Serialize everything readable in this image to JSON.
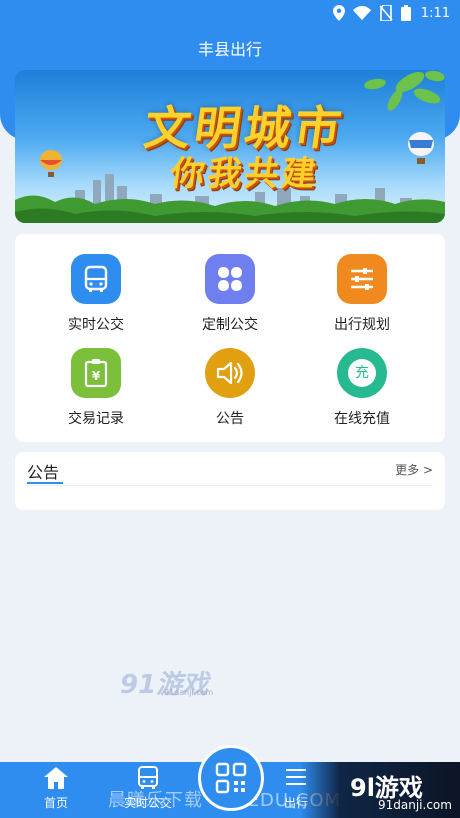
{
  "status_bar": {
    "time": "1:11"
  },
  "app": {
    "title": "丰县出行"
  },
  "banner": {
    "title": "文明城市",
    "subtitle": "你我共建"
  },
  "features": [
    {
      "label": "实时公交",
      "icon": "bus-icon",
      "color": "#2f8df0"
    },
    {
      "label": "定制公交",
      "icon": "grid-clover-icon",
      "color": "#6f7ff0"
    },
    {
      "label": "出行规划",
      "icon": "sliders-icon",
      "color": "#f08a1e"
    },
    {
      "label": "交易记录",
      "icon": "receipt-icon",
      "color": "#7cbf3a"
    },
    {
      "label": "公告",
      "icon": "speaker-icon",
      "color": "#e0a010"
    },
    {
      "label": "在线充值",
      "icon": "recharge-icon",
      "color": "#27b98f",
      "badge": "充"
    }
  ],
  "notice": {
    "title": "公告",
    "more": "更多 >"
  },
  "tabbar": {
    "tabs": [
      {
        "label": "首页",
        "icon": "home-icon"
      },
      {
        "label": "实时公交",
        "icon": "bus-icon"
      },
      {
        "label": "出行",
        "icon": "menu-icon"
      }
    ],
    "center_icon": "qr-code-icon"
  },
  "watermarks": {
    "center_logo": "91游戏",
    "center_sub": "91danji.com",
    "bottom_text": "晨曦乐下载 CXLEDU.COM",
    "corner_logo": "9l游戏",
    "corner_sub": "91danji.com"
  },
  "colors": {
    "primary": "#2f8df0",
    "background": "#edf2f9"
  }
}
